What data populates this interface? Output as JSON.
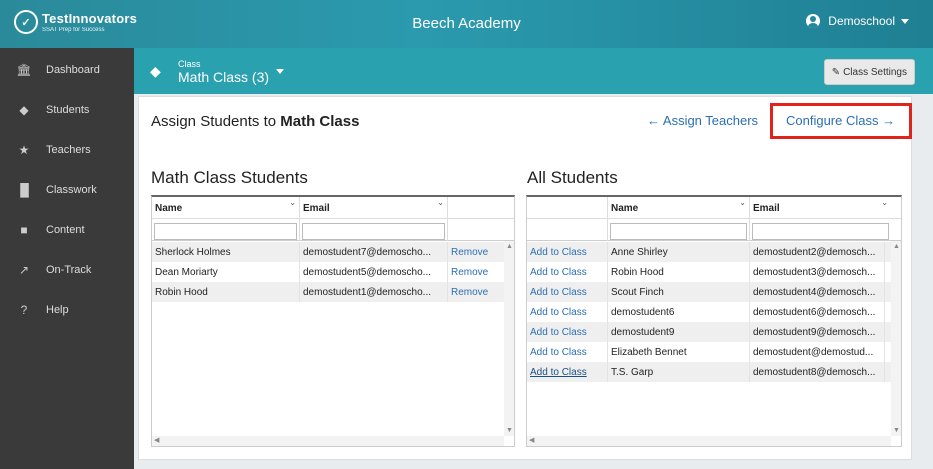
{
  "header": {
    "logo_name": "TestInnovators",
    "logo_tagline": "SSAT Prep for Success",
    "school": "Beech Academy",
    "user": "Demoschool"
  },
  "sidebar": {
    "items": [
      {
        "label": "Dashboard",
        "icon": "bank-icon"
      },
      {
        "label": "Students",
        "icon": "graduation-cap-icon"
      },
      {
        "label": "Teachers",
        "icon": "star-icon"
      },
      {
        "label": "Classwork",
        "icon": "bar-chart-icon"
      },
      {
        "label": "Content",
        "icon": "book-icon"
      },
      {
        "label": "On-Track",
        "icon": "line-chart-icon"
      },
      {
        "label": "Help",
        "icon": "question-circle-icon"
      }
    ]
  },
  "classbar": {
    "small_label": "Class",
    "class_name": "Math Class (3)",
    "settings_label": "Class Settings"
  },
  "panel": {
    "title_prefix": "Assign Students to ",
    "title_bold": "Math Class",
    "assign_teachers": "← Assign Teachers",
    "configure_class": "Configure Class →"
  },
  "class_students": {
    "title": "Math Class Students",
    "columns": [
      "Name",
      "Email"
    ],
    "rows": [
      {
        "name": "Sherlock Holmes",
        "email": "demostudent7@demoscho...",
        "action": "Remove"
      },
      {
        "name": "Dean Moriarty",
        "email": "demostudent5@demoscho...",
        "action": "Remove"
      },
      {
        "name": "Robin Hood",
        "email": "demostudent1@demoscho...",
        "action": "Remove"
      }
    ]
  },
  "all_students": {
    "title": "All Students",
    "columns": [
      "Name",
      "Email"
    ],
    "rows": [
      {
        "action": "Add to Class",
        "name": "Anne Shirley",
        "email": "demostudent2@demosch..."
      },
      {
        "action": "Add to Class",
        "name": "Robin Hood",
        "email": "demostudent3@demosch..."
      },
      {
        "action": "Add to Class",
        "name": "Scout Finch",
        "email": "demostudent4@demosch..."
      },
      {
        "action": "Add to Class",
        "name": "demostudent6",
        "email": "demostudent6@demosch..."
      },
      {
        "action": "Add to Class",
        "name": "demostudent9",
        "email": "demostudent9@demosch..."
      },
      {
        "action": "Add to Class",
        "name": "Elizabeth Bennet",
        "email": "demostudent@demostud..."
      },
      {
        "action": "Add to Class",
        "name": "T.S. Garp",
        "email": "demostudent8@demosch..."
      }
    ]
  }
}
